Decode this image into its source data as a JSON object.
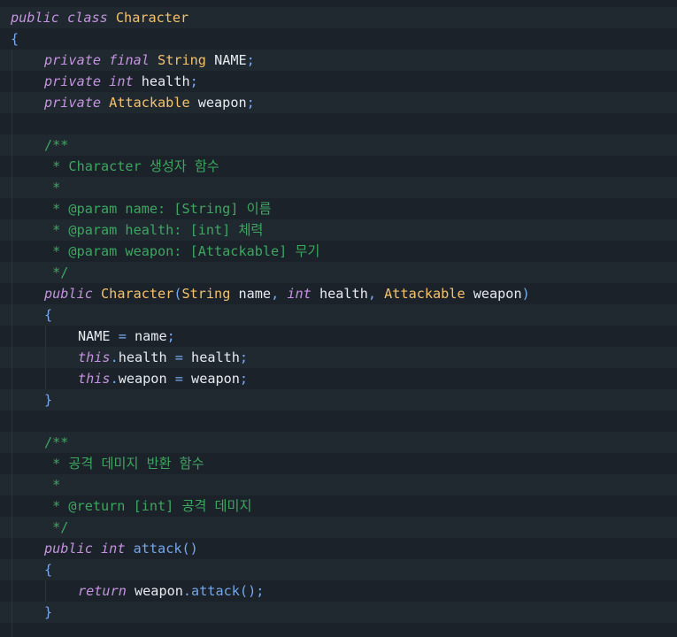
{
  "colors": {
    "background": "#1b222a",
    "line_alt": "#202830",
    "keyword": "#c594e0",
    "type": "#f5c26b",
    "function": "#74a6e8",
    "comment": "#3ea660",
    "punctuation": "#78aaf0",
    "identifier": "#e8ecf0"
  },
  "code": {
    "lines": [
      {
        "indent": 0,
        "tokens": [
          {
            "t": "kw",
            "v": "public"
          },
          {
            "t": "id",
            "v": " "
          },
          {
            "t": "kw",
            "v": "class"
          },
          {
            "t": "id",
            "v": " "
          },
          {
            "t": "ty",
            "v": "Character"
          }
        ]
      },
      {
        "indent": 0,
        "tokens": [
          {
            "t": "pn",
            "v": "{"
          }
        ]
      },
      {
        "indent": 1,
        "tokens": [
          {
            "t": "kw",
            "v": "private"
          },
          {
            "t": "id",
            "v": " "
          },
          {
            "t": "kw",
            "v": "final"
          },
          {
            "t": "id",
            "v": " "
          },
          {
            "t": "ty",
            "v": "String"
          },
          {
            "t": "id",
            "v": " NAME"
          },
          {
            "t": "pn",
            "v": ";"
          }
        ]
      },
      {
        "indent": 1,
        "tokens": [
          {
            "t": "kw",
            "v": "private"
          },
          {
            "t": "id",
            "v": " "
          },
          {
            "t": "kw",
            "v": "int"
          },
          {
            "t": "id",
            "v": " health"
          },
          {
            "t": "pn",
            "v": ";"
          }
        ]
      },
      {
        "indent": 1,
        "tokens": [
          {
            "t": "kw",
            "v": "private"
          },
          {
            "t": "id",
            "v": " "
          },
          {
            "t": "ty",
            "v": "Attackable"
          },
          {
            "t": "id",
            "v": " weapon"
          },
          {
            "t": "pn",
            "v": ";"
          }
        ]
      },
      {
        "indent": 1,
        "tokens": []
      },
      {
        "indent": 1,
        "tokens": [
          {
            "t": "cm",
            "v": "/**"
          }
        ]
      },
      {
        "indent": 1,
        "tokens": [
          {
            "t": "cm",
            "v": " * Character 생성자 함수"
          }
        ]
      },
      {
        "indent": 1,
        "tokens": [
          {
            "t": "cm",
            "v": " *"
          }
        ]
      },
      {
        "indent": 1,
        "tokens": [
          {
            "t": "cm",
            "v": " * @param name: [String] 이름"
          }
        ]
      },
      {
        "indent": 1,
        "tokens": [
          {
            "t": "cm",
            "v": " * @param health: [int] 체력"
          }
        ]
      },
      {
        "indent": 1,
        "tokens": [
          {
            "t": "cm",
            "v": " * @param weapon: [Attackable] 무기"
          }
        ]
      },
      {
        "indent": 1,
        "tokens": [
          {
            "t": "cm",
            "v": " */"
          }
        ]
      },
      {
        "indent": 1,
        "tokens": [
          {
            "t": "kw",
            "v": "public"
          },
          {
            "t": "id",
            "v": " "
          },
          {
            "t": "ty",
            "v": "Character"
          },
          {
            "t": "pn",
            "v": "("
          },
          {
            "t": "ty",
            "v": "String"
          },
          {
            "t": "id",
            "v": " name"
          },
          {
            "t": "pn",
            "v": ","
          },
          {
            "t": "id",
            "v": " "
          },
          {
            "t": "kw",
            "v": "int"
          },
          {
            "t": "id",
            "v": " health"
          },
          {
            "t": "pn",
            "v": ","
          },
          {
            "t": "id",
            "v": " "
          },
          {
            "t": "ty",
            "v": "Attackable"
          },
          {
            "t": "id",
            "v": " weapon"
          },
          {
            "t": "pn",
            "v": ")"
          }
        ]
      },
      {
        "indent": 1,
        "tokens": [
          {
            "t": "pn",
            "v": "{"
          }
        ]
      },
      {
        "indent": 2,
        "tokens": [
          {
            "t": "id",
            "v": "NAME "
          },
          {
            "t": "pn",
            "v": "="
          },
          {
            "t": "id",
            "v": " name"
          },
          {
            "t": "pn",
            "v": ";"
          }
        ]
      },
      {
        "indent": 2,
        "tokens": [
          {
            "t": "kw",
            "v": "this"
          },
          {
            "t": "pn",
            "v": "."
          },
          {
            "t": "id",
            "v": "health "
          },
          {
            "t": "pn",
            "v": "="
          },
          {
            "t": "id",
            "v": " health"
          },
          {
            "t": "pn",
            "v": ";"
          }
        ]
      },
      {
        "indent": 2,
        "tokens": [
          {
            "t": "kw",
            "v": "this"
          },
          {
            "t": "pn",
            "v": "."
          },
          {
            "t": "id",
            "v": "weapon "
          },
          {
            "t": "pn",
            "v": "="
          },
          {
            "t": "id",
            "v": " weapon"
          },
          {
            "t": "pn",
            "v": ";"
          }
        ]
      },
      {
        "indent": 1,
        "tokens": [
          {
            "t": "pn",
            "v": "}"
          }
        ]
      },
      {
        "indent": 1,
        "tokens": []
      },
      {
        "indent": 1,
        "tokens": [
          {
            "t": "cm",
            "v": "/**"
          }
        ]
      },
      {
        "indent": 1,
        "tokens": [
          {
            "t": "cm",
            "v": " * 공격 데미지 반환 함수"
          }
        ]
      },
      {
        "indent": 1,
        "tokens": [
          {
            "t": "cm",
            "v": " *"
          }
        ]
      },
      {
        "indent": 1,
        "tokens": [
          {
            "t": "cm",
            "v": " * @return [int] 공격 데미지"
          }
        ]
      },
      {
        "indent": 1,
        "tokens": [
          {
            "t": "cm",
            "v": " */"
          }
        ]
      },
      {
        "indent": 1,
        "tokens": [
          {
            "t": "kw",
            "v": "public"
          },
          {
            "t": "id",
            "v": " "
          },
          {
            "t": "kw",
            "v": "int"
          },
          {
            "t": "id",
            "v": " "
          },
          {
            "t": "fn",
            "v": "attack"
          },
          {
            "t": "pn",
            "v": "()"
          }
        ]
      },
      {
        "indent": 1,
        "tokens": [
          {
            "t": "pn",
            "v": "{"
          }
        ]
      },
      {
        "indent": 2,
        "tokens": [
          {
            "t": "kw",
            "v": "return"
          },
          {
            "t": "id",
            "v": " weapon"
          },
          {
            "t": "pn",
            "v": "."
          },
          {
            "t": "fn",
            "v": "attack"
          },
          {
            "t": "pn",
            "v": "();"
          }
        ]
      },
      {
        "indent": 1,
        "tokens": [
          {
            "t": "pn",
            "v": "}"
          }
        ]
      },
      {
        "indent": 1,
        "tokens": []
      }
    ]
  }
}
